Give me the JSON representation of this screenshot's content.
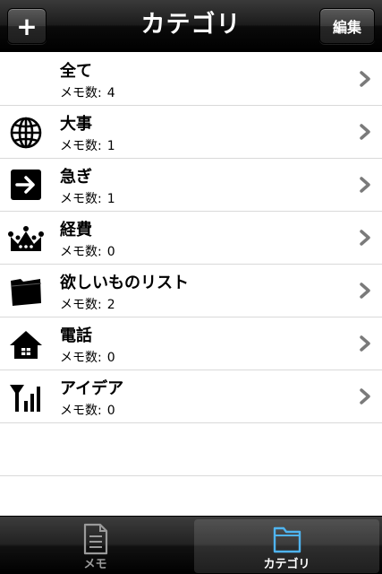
{
  "navbar": {
    "title": "カテゴリ",
    "add_label": "+",
    "edit_label": "編集"
  },
  "count_label": "メモ数:",
  "categories": [
    {
      "title": "全て",
      "count": "4",
      "icon": "none"
    },
    {
      "title": "大事",
      "count": "1",
      "icon": "globe-icon"
    },
    {
      "title": "急ぎ",
      "count": "1",
      "icon": "arrow-right-icon"
    },
    {
      "title": "経費",
      "count": "0",
      "icon": "crown-icon"
    },
    {
      "title": "欲しいものリスト",
      "count": "2",
      "icon": "folder-icon"
    },
    {
      "title": "電話",
      "count": "0",
      "icon": "house-icon"
    },
    {
      "title": "アイデア",
      "count": "0",
      "icon": "signal-icon"
    }
  ],
  "tabbar": {
    "tabs": [
      {
        "label": "メモ",
        "icon": "memo-document-icon",
        "selected": false
      },
      {
        "label": "カテゴリ",
        "icon": "folder-icon",
        "selected": true
      }
    ]
  },
  "colors": {
    "selected_tab_icon": "#4fb4f0",
    "unselected_tab": "#9a9a9a",
    "chevron": "#7a7a7a"
  }
}
